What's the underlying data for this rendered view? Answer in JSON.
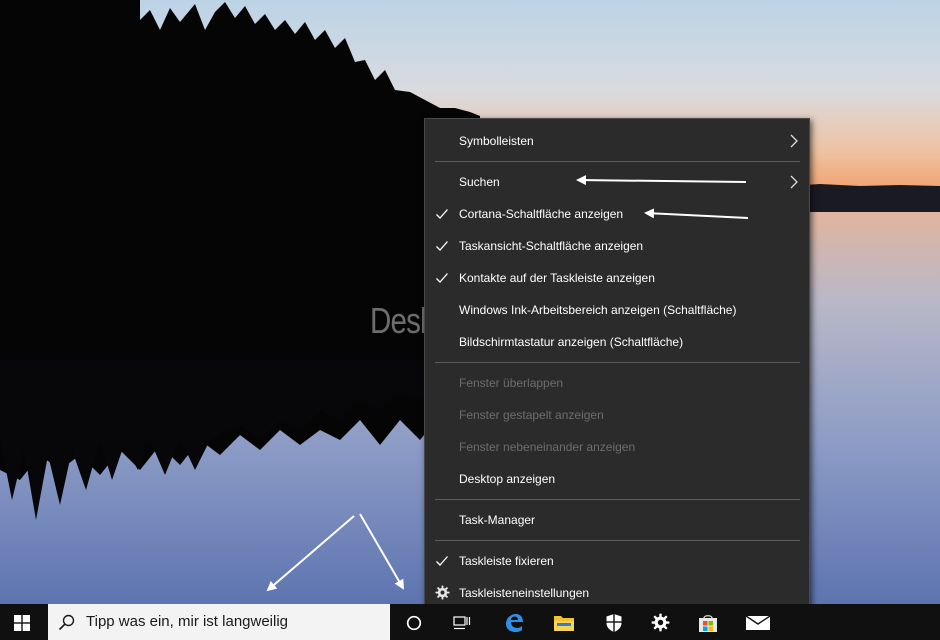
{
  "watermark": "Deskmodder.de",
  "context_menu": {
    "items": [
      {
        "label": "Symbolleisten",
        "submenu": true
      },
      {
        "label": "Suchen",
        "submenu": true
      },
      {
        "label": "Cortana-Schaltfläche anzeigen",
        "checked": true
      },
      {
        "label": "Taskansicht-Schaltfläche anzeigen",
        "checked": true
      },
      {
        "label": "Kontakte auf der Taskleiste anzeigen",
        "checked": true
      },
      {
        "label": "Windows Ink-Arbeitsbereich anzeigen (Schaltfläche)"
      },
      {
        "label": "Bildschirmtastatur anzeigen (Schaltfläche)"
      },
      {
        "label": "Fenster überlappen",
        "disabled": true
      },
      {
        "label": "Fenster gestapelt anzeigen",
        "disabled": true
      },
      {
        "label": "Fenster nebeneinander anzeigen",
        "disabled": true
      },
      {
        "label": "Desktop anzeigen"
      },
      {
        "label": "Task-Manager"
      },
      {
        "label": "Taskleiste fixieren",
        "checked": true
      },
      {
        "label": "Taskleisteneinstellungen",
        "icon": "gear-icon"
      }
    ]
  },
  "taskbar": {
    "search_placeholder": "Tipp was ein, mir ist langweilig",
    "icons": [
      "windows-start-icon",
      "search-icon",
      "cortana-icon",
      "task-view-icon",
      "edge-icon",
      "file-explorer-icon",
      "security-shield-icon",
      "settings-gear-icon",
      "store-icon",
      "mail-icon"
    ]
  },
  "colors": {
    "menu_bg": "#2b2b2b",
    "menu_text": "#ffffff",
    "menu_disabled_text": "#6d6d6d",
    "menu_separator": "#5c5c5c",
    "taskbar_bg": "#101010",
    "search_bg": "#f3f3f3"
  }
}
